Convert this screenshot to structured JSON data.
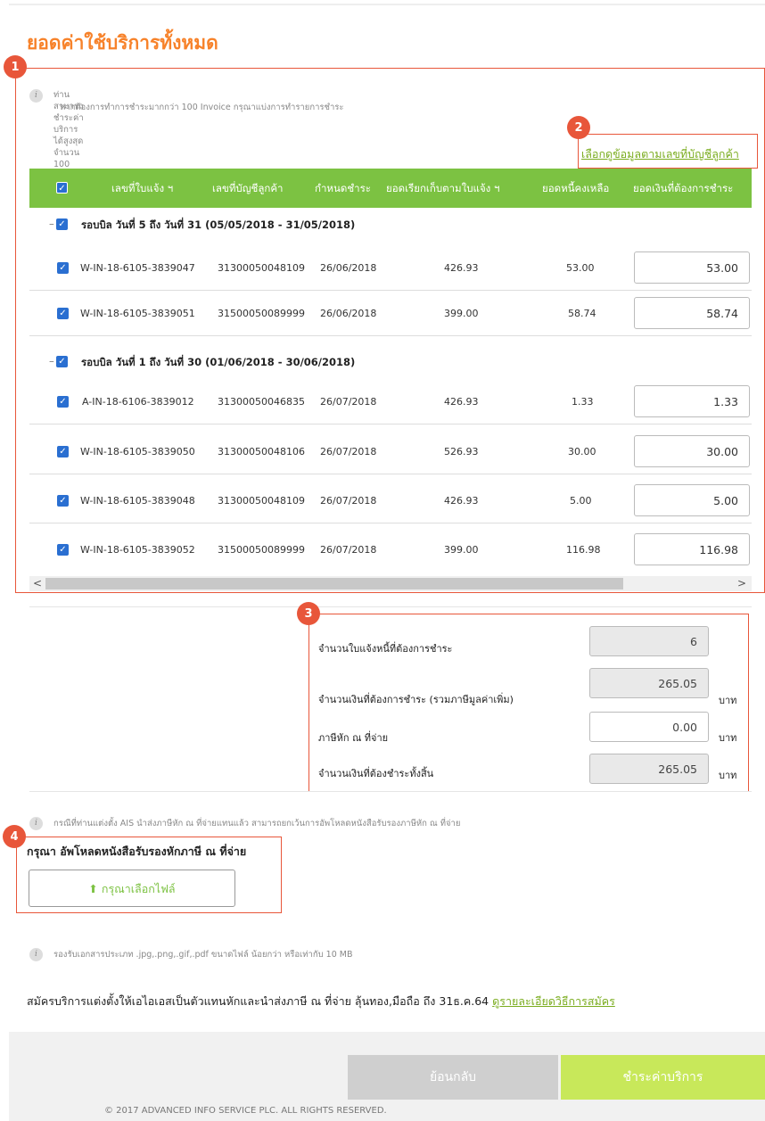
{
  "title": "ยอดค่าใช้บริการทั้งหมด",
  "badges": [
    "1",
    "2",
    "3",
    "4"
  ],
  "notes": {
    "invoice_limit_line1": "ท่านสามารถชำระค่าบริการได้สูงสุด จำนวน 100 Invoice ต่อครั้ง",
    "invoice_limit_line2": "หากต้องการทำการชำระมากกว่า 100 Invoice กรุณาแบ่งการทำรายการชำระ",
    "withholding_note": "กรณีที่ท่านแต่งตั้ง AIS นำส่งภาษีหัก ณ ที่จ่ายแทนแล้ว สามารถยกเว้นการอัพโหลดหนังสือรับรองภาษีหัก ณ ที่จ่าย",
    "file_types_note": "รองรับเอกสารประเภท .jpg,.png,.gif,.pdf ขนาดไฟล์ น้อยกว่า หรือเท่ากับ 10 MB"
  },
  "select_by_account_link": "เลือกดูข้อมูลตามเลขที่บัญชีลูกค้า",
  "table": {
    "headers": [
      "เลขที่ใบแจ้ง ฯ",
      "เลขที่บัญชีลูกค้า",
      "กำหนดชำระ",
      "ยอดเรียกเก็บตามใบแจ้ง ฯ",
      "ยอดหนี้คงเหลือ",
      "ยอดเงินที่ต้องการชำระ"
    ],
    "checkmark": "✓",
    "group_dash": "–",
    "groups": [
      {
        "label": "รอบบิล วันที่ 5 ถึง วันที่ 31 (05/05/2018 - 31/05/2018)",
        "rows": [
          {
            "invoice": "W-IN-18-6105-3839047",
            "account": "31300050048109",
            "due": "26/06/2018",
            "billed": "426.93",
            "remaining": "53.00",
            "pay": "53.00"
          },
          {
            "invoice": "W-IN-18-6105-3839051",
            "account": "31500050089999",
            "due": "26/06/2018",
            "billed": "399.00",
            "remaining": "58.74",
            "pay": "58.74"
          }
        ]
      },
      {
        "label": "รอบบิล วันที่ 1 ถึง วันที่ 30 (01/06/2018 - 30/06/2018)",
        "rows": [
          {
            "invoice": "A-IN-18-6106-3839012",
            "account": "31300050046835",
            "due": "26/07/2018",
            "billed": "426.93",
            "remaining": "1.33",
            "pay": "1.33"
          },
          {
            "invoice": "W-IN-18-6105-3839050",
            "account": "31300050048106",
            "due": "26/07/2018",
            "billed": "526.93",
            "remaining": "30.00",
            "pay": "30.00"
          },
          {
            "invoice": "W-IN-18-6105-3839048",
            "account": "31300050048109",
            "due": "26/07/2018",
            "billed": "426.93",
            "remaining": "5.00",
            "pay": "5.00"
          },
          {
            "invoice": "W-IN-18-6105-3839052",
            "account": "31500050089999",
            "due": "26/07/2018",
            "billed": "399.00",
            "remaining": "116.98",
            "pay": "116.98"
          }
        ]
      }
    ],
    "scroll_left": "<",
    "scroll_right": ">"
  },
  "summary": {
    "count_label": "จำนวนใบแจ้งหนี้ที่ต้องการชำระ",
    "count_value": "6",
    "amount_label": "จำนวนเงินที่ต้องการชำระ (รวมภาษีมูลค่าเพิ่ม)",
    "amount_value": "265.05",
    "withholding_label": "ภาษีหัก ณ ที่จ่าย",
    "withholding_value": "0.00",
    "total_label": "จำนวนเงินที่ต้องชำระทั้งสิ้น",
    "total_value": "265.05",
    "unit": "บาท"
  },
  "upload": {
    "title": "กรุณา อัพโหลดหนังสือรับรองหักภาษี ณ ที่จ่าย",
    "choose_file": "กรุณาเลือกไฟล์"
  },
  "service": {
    "text": "สมัครบริการแต่งตั้งให้เอไอเอสเป็นตัวแทนหักและนำส่งภาษี ณ ที่จ่าย ลุ้นทอง,มือถือ ถึง 31ธ.ค.64",
    "link": "ดูรายละเอียดวิธีการสมัคร"
  },
  "buttons": {
    "back": "ย้อนกลับ",
    "pay": "ชำระค่าบริการ"
  },
  "copyright": "© 2017 ADVANCED INFO SERVICE PLC. ALL RIGHTS RESERVED.",
  "colors": {
    "accent_orange": "#f7822a",
    "annotation_red": "#e8563a",
    "header_green": "#7cc242",
    "pay_button": "#c8e85a",
    "checkbox_blue": "#2a6fd1"
  },
  "icons": {
    "info": "info-icon",
    "upload": "upload-icon",
    "checkbox": "checkbox-checked-icon"
  }
}
